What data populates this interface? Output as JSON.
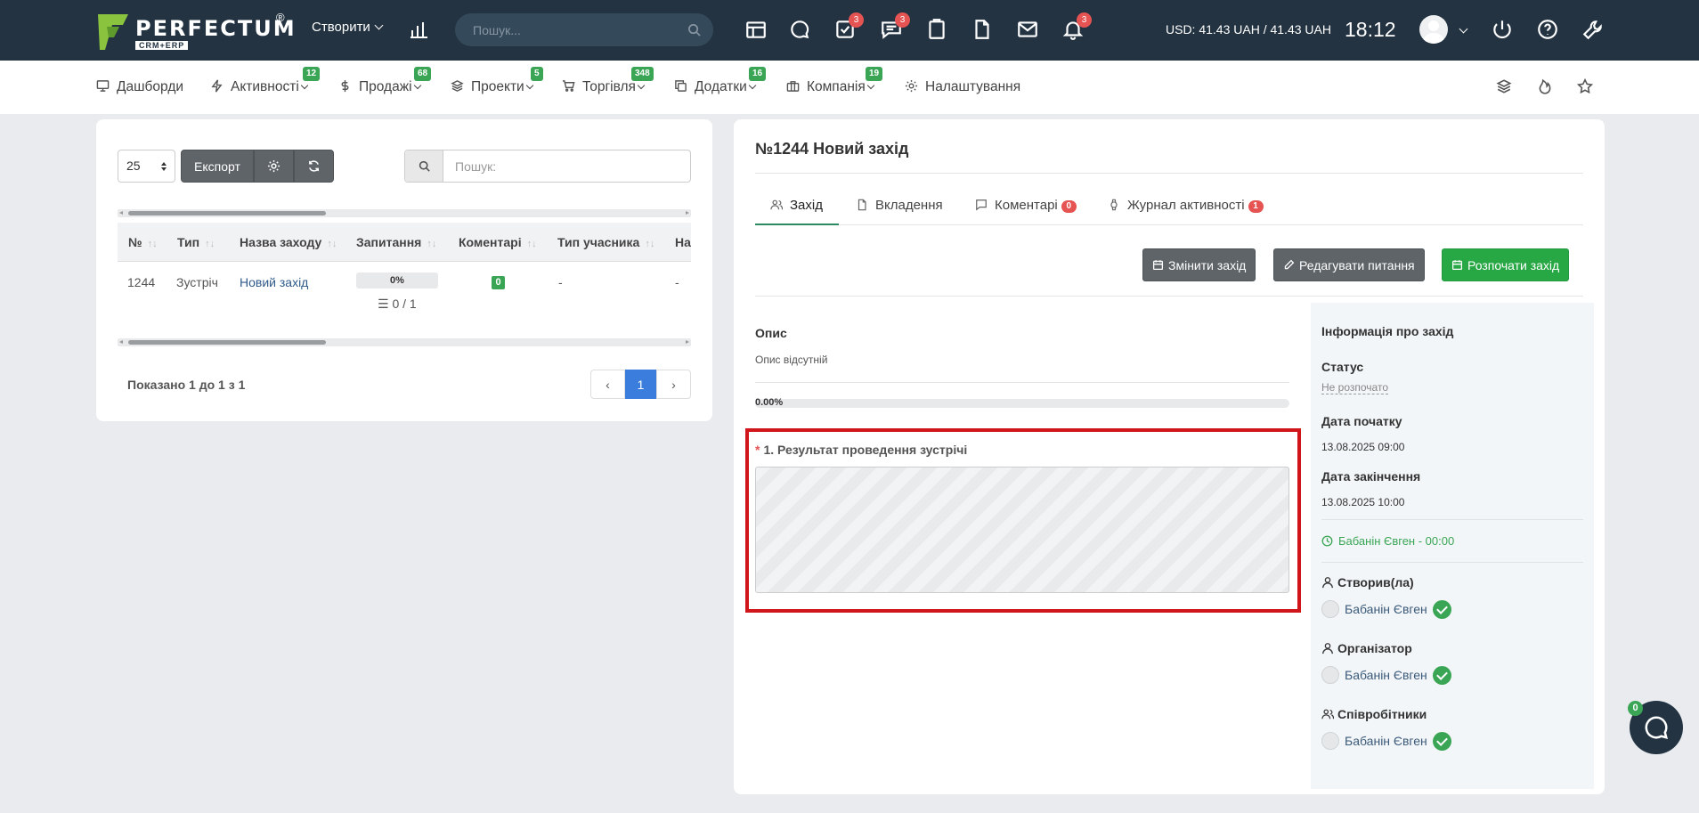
{
  "brand": {
    "name": "PERFECTUM",
    "reg": "®",
    "sub": "CRM+ERP"
  },
  "topbar": {
    "create_label": "Створити",
    "search_placeholder": "Пошук...",
    "badges": {
      "tasks": "3",
      "chat": "3",
      "notifications": "3"
    },
    "currency": "USD: 41.43 UAH / 41.43 UAH",
    "time": "18:12"
  },
  "nav": {
    "items": [
      {
        "label": "Дашборди",
        "badge": ""
      },
      {
        "label": "Активності",
        "badge": "12"
      },
      {
        "label": "Продажі",
        "badge": "68"
      },
      {
        "label": "Проекти",
        "badge": "5"
      },
      {
        "label": "Торгівля",
        "badge": "348"
      },
      {
        "label": "Додатки",
        "badge": "16"
      },
      {
        "label": "Компанія",
        "badge": "19"
      },
      {
        "label": "Налаштування",
        "badge": ""
      }
    ]
  },
  "list": {
    "page_size": "25",
    "export_label": "Експорт",
    "search_placeholder": "Пошук:",
    "columns": [
      "№",
      "Тип",
      "Назва заходу",
      "Запитання",
      "Коментарі",
      "Тип учасника",
      "На"
    ],
    "rows": [
      {
        "id": "1244",
        "type": "Зустріч",
        "name": "Новий захід",
        "progress": "0%",
        "questions": "0 / 1",
        "comments": "0",
        "participant_type": "-",
        "extra": "-"
      }
    ],
    "shown_text": "Показано 1 до 1 з 1",
    "current_page": "1"
  },
  "detail": {
    "title": "№1244 Новий захід",
    "tabs": [
      {
        "label": "Захід",
        "badge": ""
      },
      {
        "label": "Вкладення",
        "badge": ""
      },
      {
        "label": "Коментарі",
        "badge": "0"
      },
      {
        "label": "Журнал активності",
        "badge": "1"
      }
    ],
    "actions": {
      "change": "Змінити захід",
      "edit_questions": "Редагувати питання",
      "start": "Розпочати захід"
    },
    "description_label": "Опис",
    "description_text": "Опис відсутній",
    "progress_text": "0.00%",
    "question_label": "1. Результат проведення зустрічі",
    "question_required": "*"
  },
  "info": {
    "title": "Інформація про захід",
    "status_label": "Статус",
    "status_value": "Не розпочато",
    "start_label": "Дата початку",
    "start_value": "13.08.2025 09:00",
    "end_label": "Дата закінчення",
    "end_value": "13.08.2025 10:00",
    "timer": "Бабанін Євген - 00:00",
    "created_label": "Створив(ла)",
    "created_by": "Бабанін Євген",
    "organizer_label": "Організатор",
    "organizer": "Бабанін Євген",
    "staff_label": "Співробітники",
    "staff": "Бабанін Євген"
  },
  "chat": {
    "badge": "0"
  },
  "colors": {
    "topbar": "#233342",
    "accent_green": "#3aa655",
    "badge_red": "#e55353",
    "link": "#3b7ddd"
  }
}
